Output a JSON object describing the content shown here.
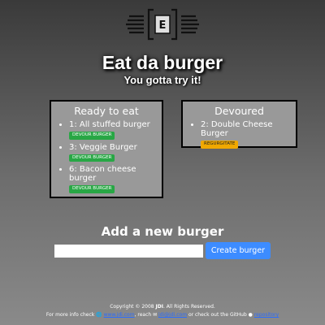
{
  "header": {
    "logo_letter": "E",
    "title": "Eat da burger",
    "subtitle": "You gotta try it!"
  },
  "ready_panel": {
    "heading": "Ready to eat",
    "items": [
      {
        "label": "1: All stuffed burger",
        "button": "DEVOUR BURGER"
      },
      {
        "label": "3: Veggie Burger",
        "button": "DEVOUR BURGER"
      },
      {
        "label": "6: Bacon cheese burger",
        "button": "DEVOUR BURGER"
      }
    ]
  },
  "devoured_panel": {
    "heading": "Devoured",
    "items": [
      {
        "label": "2: Double Cheese Burger",
        "button": "REGURGITATE"
      }
    ]
  },
  "add_form": {
    "heading": "Add a new burger",
    "input_value": "",
    "input_placeholder": "",
    "submit_label": "Create burger"
  },
  "footer": {
    "copyright_prefix": "Copyright © 2008 ",
    "copyright_brand": "JDI",
    "copyright_suffix": ". All Rights Reserved.",
    "info_prefix": "For more info check ",
    "website_link": "www.jdi.com",
    "reach_text": ", reach ",
    "email_link": "jdi@jdi.com",
    "github_text": " or check out the GitHub ",
    "repo_link": "repository"
  },
  "colors": {
    "devour_button": "#28a745",
    "regurgitate_button": "#f0a800",
    "create_button": "#3d8cff",
    "panel_background": "#999999"
  }
}
